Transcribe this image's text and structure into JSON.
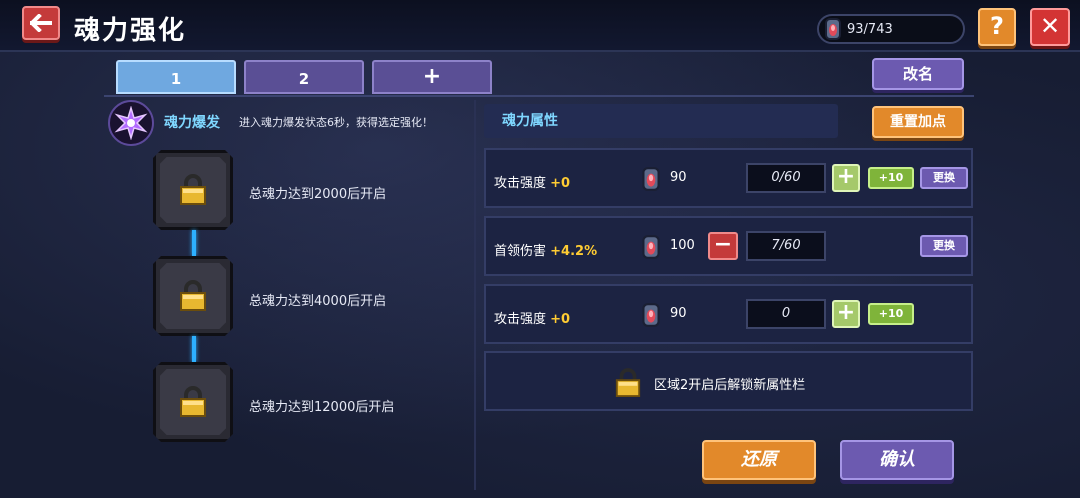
{
  "header": {
    "title": "魂力强化",
    "currency": "93/743",
    "help_label": "?",
    "close_label": "✕"
  },
  "tabs": [
    {
      "label": "1",
      "active": true
    },
    {
      "label": "2",
      "active": false
    },
    {
      "label": "+",
      "active": false
    }
  ],
  "rename_label": "改名",
  "burst": {
    "title": "魂力爆发",
    "description": "进入魂力爆发状态6秒，获得选定强化！"
  },
  "unlock_slots": [
    {
      "text": "总魂力达到2000后开启"
    },
    {
      "text": "总魂力达到4000后开启"
    },
    {
      "text": "总魂力达到12000后开启"
    }
  ],
  "attributes": {
    "header": "魂力属性",
    "reset_label": "重置加点",
    "rows": [
      {
        "name": "攻击强度",
        "bonus": "+0",
        "cost": "90",
        "points": "0/60",
        "plus10": "+10",
        "swap": "更换"
      },
      {
        "name": "首领伤害",
        "bonus": "+4.2%",
        "cost": "100",
        "points": "7/60",
        "swap": "更换"
      },
      {
        "name": "攻击强度",
        "bonus": "+0",
        "cost": "90",
        "points": "0",
        "plus10": "+10"
      }
    ],
    "locked_text": "区域2开启后解锁新属性栏"
  },
  "footer": {
    "restore_label": "还原",
    "confirm_label": "确认"
  },
  "colors": {
    "accent_blue": "#7fd7ff",
    "bonus_yellow": "#ffcc33",
    "orange_button": "#e2892a",
    "purple_button": "#6c5ab0"
  }
}
